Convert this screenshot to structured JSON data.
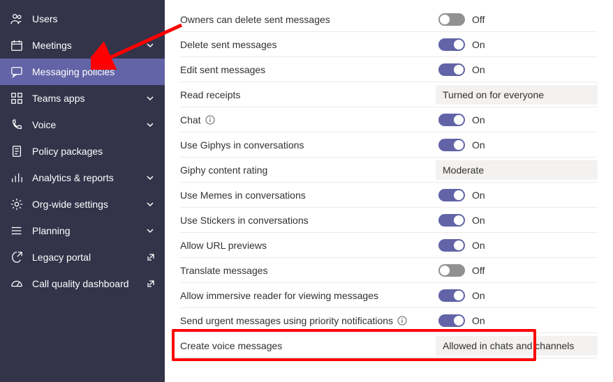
{
  "sidebar": {
    "items": [
      {
        "label": "Users",
        "icon": "users-icon",
        "chev": false,
        "ext": false
      },
      {
        "label": "Meetings",
        "icon": "meetings-icon",
        "chev": true,
        "ext": false
      },
      {
        "label": "Messaging policies",
        "icon": "messaging-icon",
        "chev": false,
        "ext": false,
        "active": true
      },
      {
        "label": "Teams apps",
        "icon": "apps-icon",
        "chev": true,
        "ext": false
      },
      {
        "label": "Voice",
        "icon": "voice-icon",
        "chev": true,
        "ext": false
      },
      {
        "label": "Policy packages",
        "icon": "policy-icon",
        "chev": false,
        "ext": false
      },
      {
        "label": "Analytics & reports",
        "icon": "analytics-icon",
        "chev": true,
        "ext": false
      },
      {
        "label": "Org-wide settings",
        "icon": "settings-icon",
        "chev": true,
        "ext": false
      },
      {
        "label": "Planning",
        "icon": "planning-icon",
        "chev": true,
        "ext": false
      },
      {
        "label": "Legacy portal",
        "icon": "legacy-icon",
        "chev": false,
        "ext": true
      },
      {
        "label": "Call quality dashboard",
        "icon": "dashboard-icon",
        "chev": false,
        "ext": true
      }
    ]
  },
  "settings": [
    {
      "label": "Owners can delete sent messages",
      "type": "toggle",
      "on": false,
      "text": "Off",
      "info": false
    },
    {
      "label": "Delete sent messages",
      "type": "toggle",
      "on": true,
      "text": "On",
      "info": false
    },
    {
      "label": "Edit sent messages",
      "type": "toggle",
      "on": true,
      "text": "On",
      "info": false
    },
    {
      "label": "Read receipts",
      "type": "select",
      "value": "Turned on for everyone",
      "info": false
    },
    {
      "label": "Chat",
      "type": "toggle",
      "on": true,
      "text": "On",
      "info": true
    },
    {
      "label": "Use Giphys in conversations",
      "type": "toggle",
      "on": true,
      "text": "On",
      "info": false
    },
    {
      "label": "Giphy content rating",
      "type": "select",
      "value": "Moderate",
      "info": false
    },
    {
      "label": "Use Memes in conversations",
      "type": "toggle",
      "on": true,
      "text": "On",
      "info": false
    },
    {
      "label": "Use Stickers in conversations",
      "type": "toggle",
      "on": true,
      "text": "On",
      "info": false
    },
    {
      "label": "Allow URL previews",
      "type": "toggle",
      "on": true,
      "text": "On",
      "info": false
    },
    {
      "label": "Translate messages",
      "type": "toggle",
      "on": false,
      "text": "Off",
      "info": false
    },
    {
      "label": "Allow immersive reader for viewing messages",
      "type": "toggle",
      "on": true,
      "text": "On",
      "info": false
    },
    {
      "label": "Send urgent messages using priority notifications",
      "type": "toggle",
      "on": true,
      "text": "On",
      "info": true
    },
    {
      "label": "Create voice messages",
      "type": "select",
      "value": "Allowed in chats and channels",
      "info": false
    }
  ]
}
